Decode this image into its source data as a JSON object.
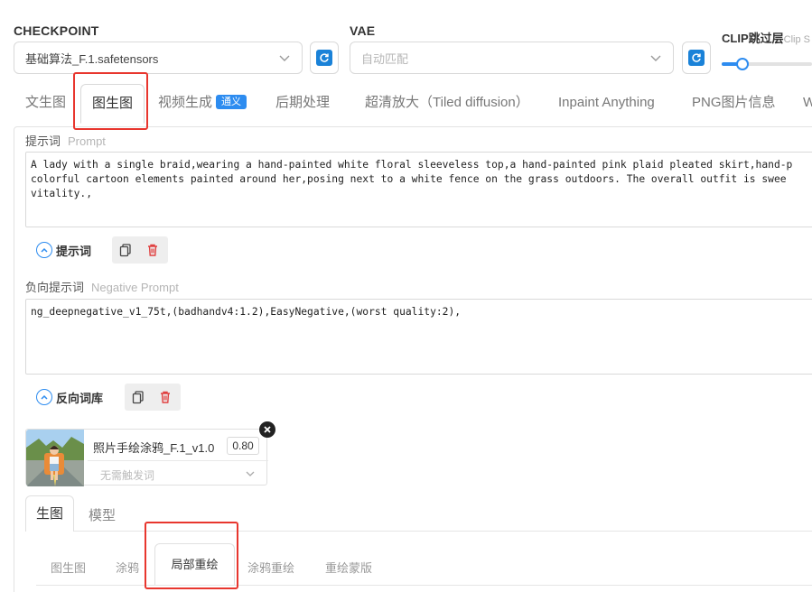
{
  "header": {
    "checkpoint_label": "CHECKPOINT",
    "checkpoint_value": "基础算法_F.1.safetensors",
    "vae_label": "VAE",
    "vae_value": "自动匹配",
    "clip_label": "CLIP跳过层",
    "clip_sub": "Clip S",
    "clip_slider_fraction": 0.23
  },
  "tabs": [
    {
      "label": "文生图"
    },
    {
      "label": "图生图"
    },
    {
      "label": "视频生成",
      "badge": "通义"
    },
    {
      "label": "后期处理"
    },
    {
      "label": "超清放大（Tiled diffusion）"
    },
    {
      "label": "Inpaint Anything"
    },
    {
      "label": "PNG图片信息"
    },
    {
      "label": "W"
    }
  ],
  "prompt": {
    "label": "提示词",
    "label_en": "Prompt",
    "lines": [
      "A lady with a single braid,wearing a hand-painted white floral sleeveless top,a hand-painted pink plaid pleated skirt,hand-p",
      "colorful cartoon elements painted around her,posing next to a white fence on the grass outdoors. The overall outfit is swee",
      "vitality.,"
    ],
    "tool_title": "提示词"
  },
  "negative": {
    "label": "负向提示词",
    "label_en": "Negative Prompt",
    "text": "ng_deepnegative_v1_75t,(badhandv4:1.2),EasyNegative,(worst quality:2),",
    "tool_title": "反向词库"
  },
  "lora": {
    "name": "照片手绘涂鸦_F.1_v1.0",
    "weight": "0.80",
    "trigger_placeholder": "无需触发词"
  },
  "sub_tabs": [
    {
      "label": "生图"
    },
    {
      "label": "模型"
    }
  ],
  "mode_tabs": [
    {
      "label": "图生图"
    },
    {
      "label": "涂鸦"
    },
    {
      "label": "局部重绘"
    },
    {
      "label": "涂鸦重绘"
    },
    {
      "label": "重绘蒙版"
    }
  ],
  "colors": {
    "accent": "#2d8cf0",
    "highlight": "#e8362e",
    "delete": "#e04040"
  }
}
